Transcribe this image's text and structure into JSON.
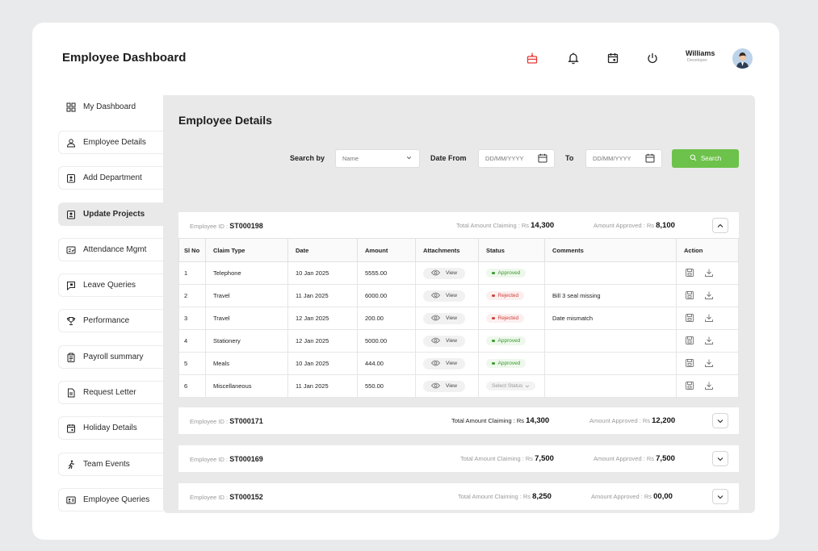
{
  "app": {
    "title": "Employee Dashboard"
  },
  "user": {
    "name": "Williams",
    "role": "Developer"
  },
  "header_icons": [
    "cake-icon",
    "bell-icon",
    "calendar-icon",
    "power-icon"
  ],
  "colors": {
    "accent": "#6cc24a",
    "approved": "#3a9a2f",
    "rejected": "#d0413a",
    "cake": "#e53935"
  },
  "sidebar": {
    "items": [
      {
        "label": "My Dashboard",
        "icon": "dashboard-icon"
      },
      {
        "label": "Employee Details",
        "icon": "user-icon"
      },
      {
        "label": "Add Department",
        "icon": "id-badge-icon"
      },
      {
        "label": "Update Projects",
        "icon": "id-badge-icon",
        "active": true
      },
      {
        "label": "Attendance Mgmt",
        "icon": "attendance-icon"
      },
      {
        "label": "Leave Queries",
        "icon": "flag-message-icon"
      },
      {
        "label": "Performance",
        "icon": "trophy-icon"
      },
      {
        "label": "Payroll summary",
        "icon": "clipboard-icon"
      },
      {
        "label": "Request Letter",
        "icon": "document-icon"
      },
      {
        "label": "Holiday Details",
        "icon": "calendar-icon"
      },
      {
        "label": "Team Events",
        "icon": "running-person-icon"
      },
      {
        "label": "Employee Queries",
        "icon": "contact-card-icon"
      }
    ]
  },
  "main": {
    "title": "Employee Details",
    "filters": {
      "search_by_label": "Search by",
      "search_by_value": "Name",
      "date_from_label": "Date From",
      "date_from_placeholder": "DD/MM/YYYY",
      "to_label": "To",
      "date_to_placeholder": "DD/MM/YYYY",
      "search_button": "Search"
    },
    "employees": [
      {
        "id_label": "Employee ID :",
        "id": "ST000198",
        "claim_label": "Total Amount Claiming  : Rs",
        "claim": "14,300",
        "approved_label": "Amount Approved  : Rs",
        "approved": "8,100",
        "expanded": true
      },
      {
        "id_label": "Employee ID :",
        "id": "ST000171",
        "claim_label": "Total Amount Claiming  : Rs",
        "claim": "14,300",
        "approved_label": "Amount Approved  : Rs",
        "approved": "12,200",
        "expanded": false
      },
      {
        "id_label": "Employee ID :",
        "id": "ST000169",
        "claim_label": "Total Amount Claiming  : Rs",
        "claim": "7,500",
        "approved_label": "Amount Approved  : Rs",
        "approved": "7,500",
        "expanded": false
      },
      {
        "id_label": "Employee ID :",
        "id": "ST000152",
        "claim_label": "Total Amount Claiming  : Rs",
        "claim": "8,250",
        "approved_label": "Amount Approved  : Rs",
        "approved": "00,00",
        "expanded": false
      }
    ],
    "table": {
      "headers": [
        "Sl No",
        "Claim Type",
        "Date",
        "Amount",
        "Attachments",
        "Status",
        "Comments",
        "Action"
      ],
      "view_label": "View",
      "select_status_label": "Select Status",
      "rows": [
        {
          "sl": "1",
          "type": "Telephone",
          "date": "10 Jan 2025",
          "amount": "5555.00",
          "status": "Approved",
          "comment": ""
        },
        {
          "sl": "2",
          "type": "Travel",
          "date": "11 Jan 2025",
          "amount": "6000.00",
          "status": "Rejected",
          "comment": "Bill 3 seal missing"
        },
        {
          "sl": "3",
          "type": "Travel",
          "date": "12 Jan 2025",
          "amount": "200.00",
          "status": "Rejected",
          "comment": "Date mismatch"
        },
        {
          "sl": "4",
          "type": "Stationery",
          "date": "12 Jan 2025",
          "amount": "5000.00",
          "status": "Approved",
          "comment": ""
        },
        {
          "sl": "5",
          "type": "Meals",
          "date": "10 Jan 2025",
          "amount": "444.00",
          "status": "Approved",
          "comment": ""
        },
        {
          "sl": "6",
          "type": "Miscellaneous",
          "date": "11 Jan 2025",
          "amount": "550.00",
          "status": "",
          "comment": ""
        }
      ]
    }
  }
}
